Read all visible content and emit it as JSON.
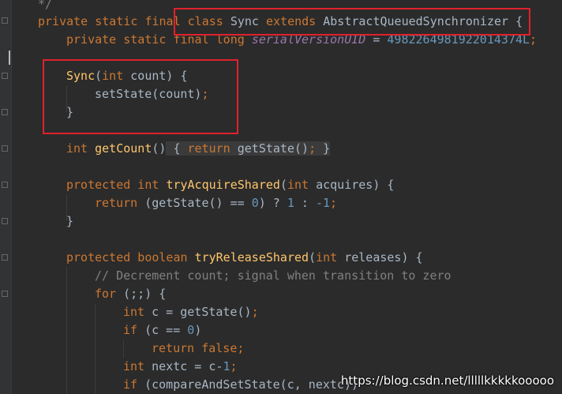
{
  "theme": {
    "background": "#2b2b2b",
    "keyword": "#cc7832",
    "method": "#ffc66d",
    "field": "#9876aa",
    "number": "#6897bb",
    "comment": "#808080",
    "text": "#a9b7c6",
    "highlight_box": "#e0212d"
  },
  "code": {
    "l1": {
      "text": "*/"
    },
    "l2": {
      "kw1": "private static final class",
      "sp1": " ",
      "name": "Sync",
      "sp2": " ",
      "kw2": "extends",
      "rest": " AbstractQueuedSynchronizer {"
    },
    "l3": {
      "kw": "private static final long",
      "sp": " ",
      "field": "serialVersionUID",
      "eq": " = ",
      "num": "4982264981922014374L",
      "semi": ";"
    },
    "l4": {
      "name": "Sync",
      "p1": "(",
      "kw": "int",
      "rest": " count) {"
    },
    "l5": {
      "text": "setState(count)",
      "semi": ";"
    },
    "l6": {
      "text": "}"
    },
    "l7": {
      "kw": "int",
      "sp": " ",
      "name": "getCount",
      "p": "()",
      "chip_open": " { ",
      "kw2": "return",
      "mid": " getState()",
      "semi": ";",
      "chip_close": " }"
    },
    "l8": {
      "kw": "protected int",
      "sp": " ",
      "name": "tryAcquireShared",
      "p1": "(",
      "kw2": "int",
      "rest": " acquires) {"
    },
    "l9": {
      "kw": "return",
      "a": " (getState() == ",
      "n0": "0",
      "b": ") ? ",
      "n1": "1",
      "c": " : ",
      "n2": "-1",
      "semi": ";"
    },
    "l10": {
      "text": "}"
    },
    "l11": {
      "kw": "protected boolean",
      "sp": " ",
      "name": "tryReleaseShared",
      "p1": "(",
      "kw2": "int",
      "rest": " releases) {"
    },
    "l12": {
      "text": "// Decrement count; signal when transition to zero"
    },
    "l13": {
      "kw": "for",
      "rest": " (;;) {"
    },
    "l14": {
      "kw": "int",
      "rest": " c = getState()",
      "semi": ";"
    },
    "l15": {
      "kw": "if",
      "a": " (c == ",
      "n": "0",
      "b": ")"
    },
    "l16": {
      "kw": "return false",
      "semi": ";"
    },
    "l17": {
      "kw": "int",
      "a": " nextc = c-",
      "n": "1",
      "semi": ";"
    },
    "l18": {
      "kw": "if",
      "rest": " (compareAndSetState(c, nextc))"
    }
  },
  "watermark": "https://blog.csdn.net/lllllkkkkkooooo"
}
